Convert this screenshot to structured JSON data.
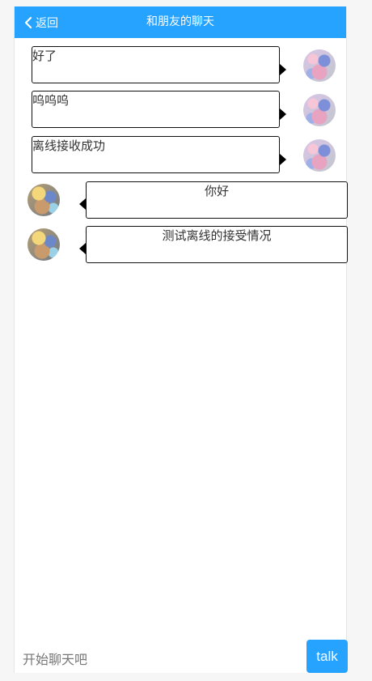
{
  "header": {
    "back_label": "返回",
    "title": "和朋友的聊天"
  },
  "messages": [
    {
      "from": "self",
      "text": "好了"
    },
    {
      "from": "self",
      "text": "呜呜呜"
    },
    {
      "from": "self",
      "text": "离线接收成功"
    },
    {
      "from": "friend",
      "text": "你好"
    },
    {
      "from": "friend",
      "text": "测试离线的接受情况"
    }
  ],
  "input": {
    "placeholder": "开始聊天吧",
    "value": ""
  },
  "send_button": {
    "label": "talk"
  },
  "colors": {
    "accent": "#26a2ff",
    "bubble_border": "#111111",
    "background": "#f6f6f7"
  },
  "icons": {
    "back": "chevron-left-icon",
    "self_avatar": "avatar",
    "friend_avatar": "avatar"
  }
}
